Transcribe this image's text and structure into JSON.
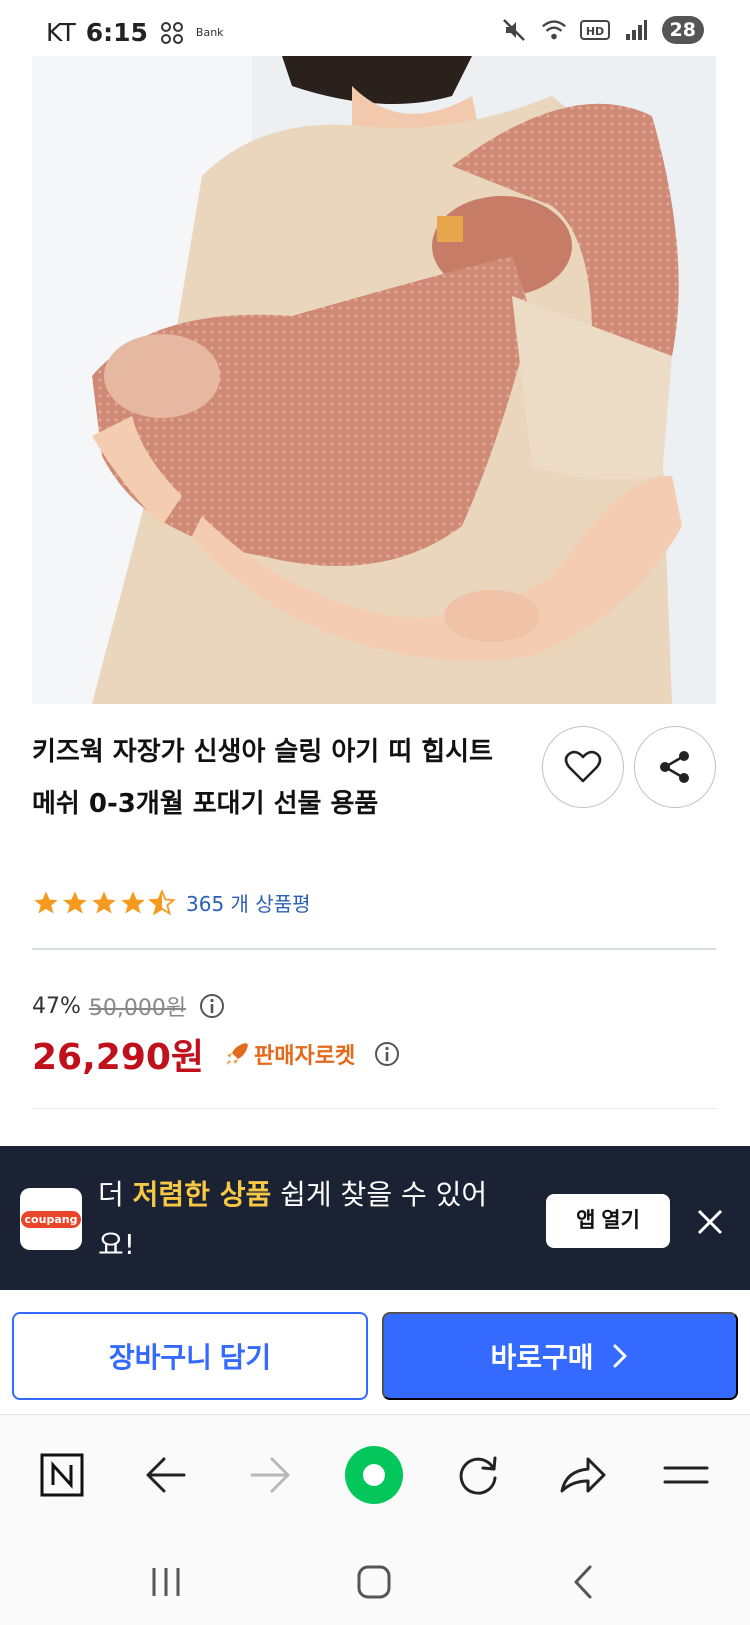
{
  "status_bar": {
    "carrier": "KT",
    "time": "6:15",
    "app_badge": "Bank",
    "battery": "28"
  },
  "product": {
    "title": "키즈웍 자장가 신생아 슬링 아기 띠 힙시트 메쉬 0-3개월 포대기 선물 용품",
    "rating": 4.5,
    "review_count": "365 개 상품평"
  },
  "price": {
    "discount_rate": "47%",
    "original_price": "50,000원",
    "sale_price": "26,290원",
    "seller_badge": "판매자로켓"
  },
  "app_banner": {
    "text_prefix": "더 ",
    "text_highlight": "저렴한 상품",
    "text_suffix": " 쉽게 찾을 수 있어요!",
    "logo_text": "coupang",
    "open_button": "앱 열기"
  },
  "purchase": {
    "cart_button": "장바구니 담기",
    "buy_button": "바로구매"
  },
  "colors": {
    "brand_blue": "#346aff",
    "sale_red": "#c0101b",
    "star_orange": "#f59a1f",
    "banner_bg": "#1b2233",
    "highlight_yellow": "#f7c843",
    "naver_green": "#03c75a"
  },
  "browser_toolbar": {
    "home_icon": "naver-n-icon",
    "back_icon": "arrow-left-icon",
    "forward_icon": "arrow-right-icon",
    "center_icon": "green-dot-icon",
    "refresh_icon": "refresh-icon",
    "share_icon": "share-arrow-icon",
    "menu_icon": "menu-icon"
  }
}
